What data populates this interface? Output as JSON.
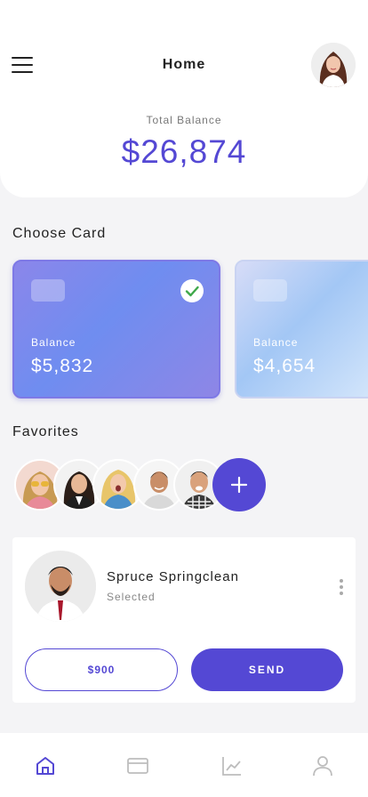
{
  "header": {
    "title": "Home",
    "menu_icon": "hamburger-menu-icon",
    "avatar": "profile-avatar"
  },
  "balance": {
    "label": "Total Balance",
    "value": "$26,874"
  },
  "cards_section": {
    "title": "Choose Card",
    "cards": [
      {
        "label": "Balance",
        "amount": "$5,832",
        "selected": true
      },
      {
        "label": "Balance",
        "amount": "$4,654",
        "selected": false
      }
    ]
  },
  "favorites": {
    "title": "Favorites",
    "add_icon": "plus-icon"
  },
  "contact": {
    "name": "Spruce Springclean",
    "status": "Selected",
    "amount_button": "$900",
    "send_button": "SEND"
  },
  "bottom_nav": {
    "items": [
      "home-icon",
      "card-icon",
      "chart-icon",
      "user-icon"
    ],
    "active_index": 0
  },
  "colors": {
    "accent": "#5448d4",
    "inactive": "#bdbdbd",
    "background": "#f4f4f6"
  }
}
